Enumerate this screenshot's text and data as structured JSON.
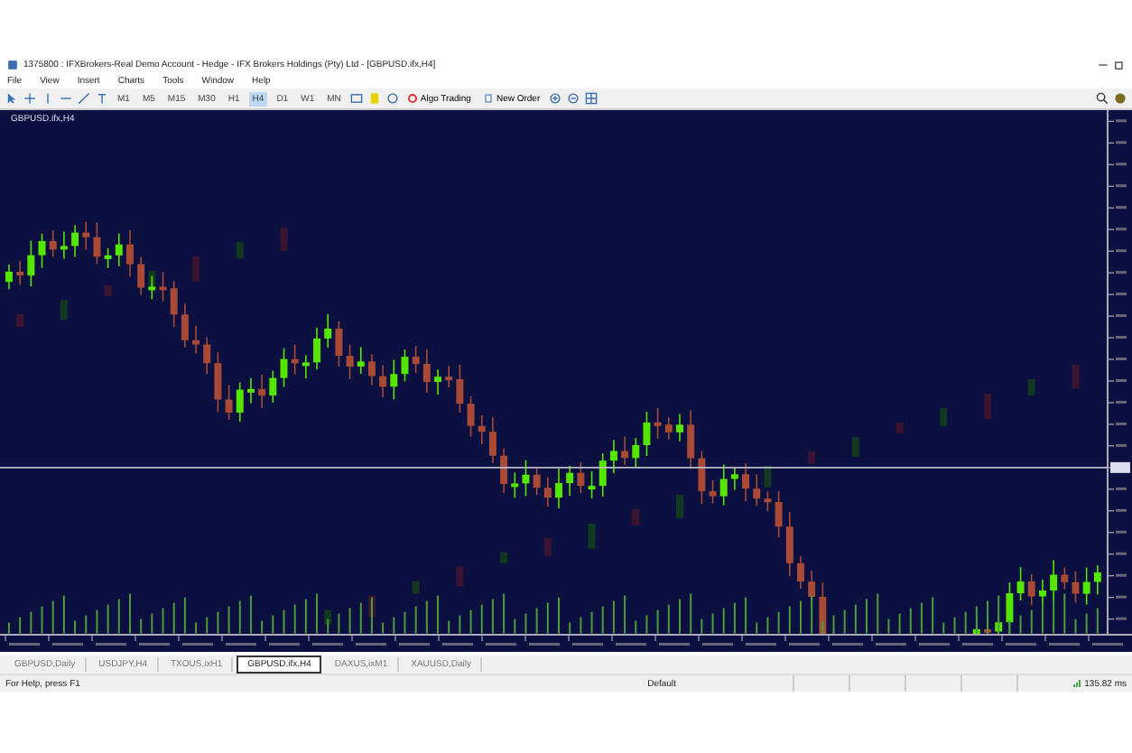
{
  "window": {
    "title": "1375800 : IFXBrokers-Real Demo Account - Hedge - IFX Brokers Holdings (Pty) Ltd - [GBPUSD.ifx,H4]"
  },
  "menu": [
    "File",
    "View",
    "Insert",
    "Charts",
    "Tools",
    "Window",
    "Help"
  ],
  "toolbar": {
    "timeframes": [
      {
        "label": "M1",
        "selected": false
      },
      {
        "label": "M5",
        "selected": false
      },
      {
        "label": "M15",
        "selected": false
      },
      {
        "label": "M30",
        "selected": false
      },
      {
        "label": "H1",
        "selected": false
      },
      {
        "label": "H4",
        "selected": true
      },
      {
        "label": "D1",
        "selected": false
      },
      {
        "label": "W1",
        "selected": false
      },
      {
        "label": "MN",
        "selected": false
      }
    ],
    "buttons": [
      {
        "kind": "algo",
        "label": "Algo Trading"
      },
      {
        "kind": "order",
        "label": "New Order"
      }
    ]
  },
  "chart": {
    "symbol_label": "GBPUSD.ifx,H4"
  },
  "tabs": [
    {
      "label": "GBPUSD,Daily",
      "selected": false
    },
    {
      "label": "USDJPY,H4",
      "selected": false
    },
    {
      "label": "TXOUS,ixH1",
      "selected": false
    },
    {
      "label": "GBPUSD.ifx,H4",
      "selected": true
    },
    {
      "label": "DAXUS,ixM1",
      "selected": false
    },
    {
      "label": "XAUUSD,Daily",
      "selected": false
    }
  ],
  "status_bar": {
    "help": "For Help, press F1",
    "profile": "Default",
    "ping": "135.82 ms"
  }
}
